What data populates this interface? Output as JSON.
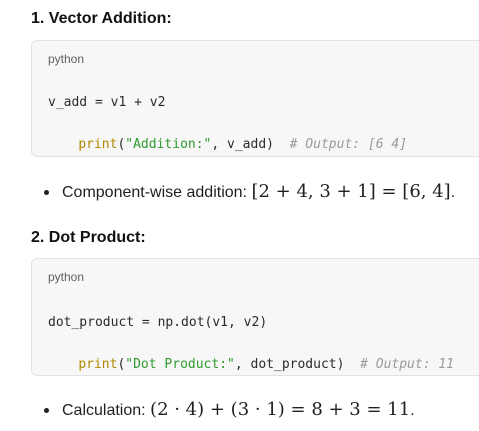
{
  "sections": [
    {
      "heading": "1. Vector Addition:",
      "code": {
        "language": "python",
        "line1": "v_add = v1 + v2",
        "line2_fn": "print",
        "line2_open": "(",
        "line2_str": "\"Addition:\"",
        "line2_rest": ", v_add)  ",
        "line2_comment": "# Output: [6 4]"
      },
      "bullet": {
        "text": "Component-wise addition: ",
        "math": "[2 + 4, 3 + 1] = [6, 4]",
        "tail": "."
      }
    },
    {
      "heading": "2. Dot Product:",
      "code": {
        "language": "python",
        "line1": "dot_product = np.dot(v1, v2)",
        "line2_fn": "print",
        "line2_open": "(",
        "line2_str": "\"Dot Product:\"",
        "line2_rest": ", dot_product)  ",
        "line2_comment": "# Output: 11"
      },
      "bullet": {
        "text": "Calculation: ",
        "math": "(2 · 4) + (3 · 1) = 8 + 3 = 11",
        "tail": "."
      }
    }
  ],
  "colors": {
    "keyword": "#b08800",
    "string": "#2f9b2f",
    "comment": "#9a9a9a",
    "code_bg": "#f7f7f7"
  }
}
